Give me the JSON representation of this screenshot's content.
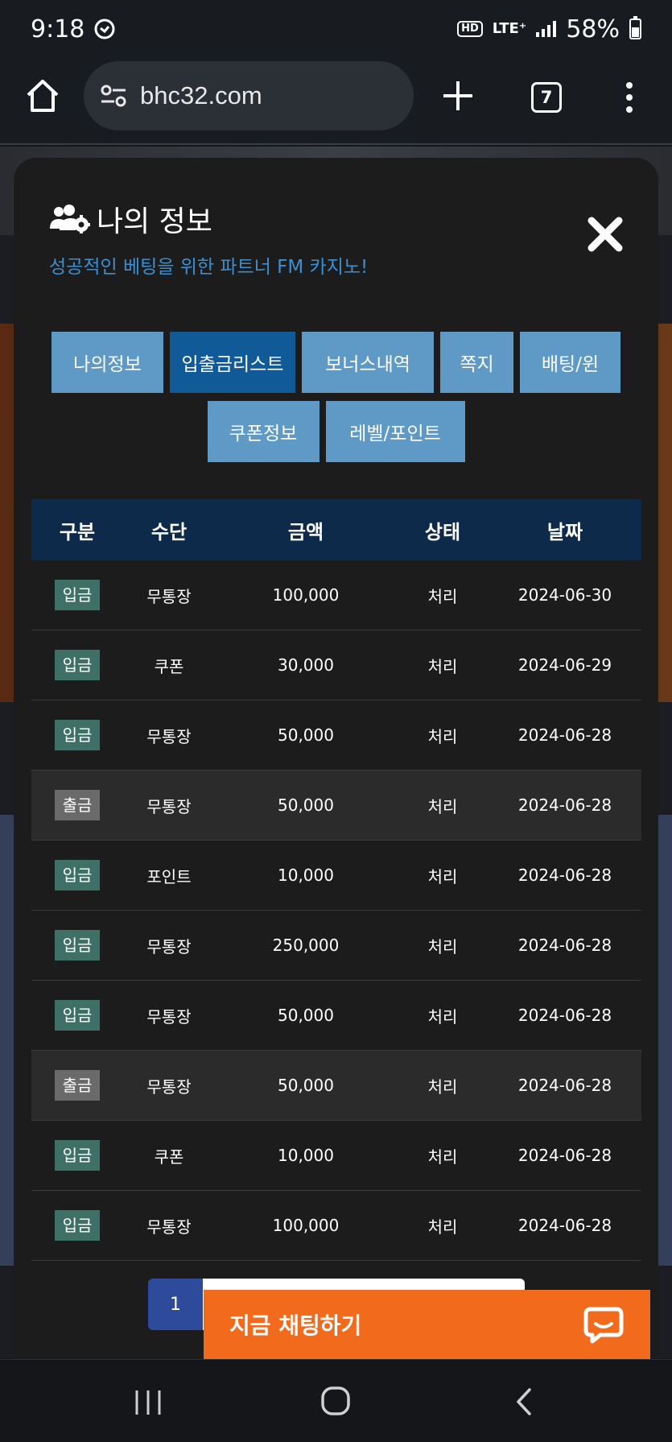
{
  "status_bar": {
    "time": "9:18",
    "hd_badge": "HD",
    "network": "LTE⁺",
    "battery": "58%"
  },
  "browser": {
    "url": "bhc32.com",
    "tab_count": "7"
  },
  "modal": {
    "title": "나의 정보",
    "subtitle": "성공적인 베팅을 위한 파트너 FM 카지노!",
    "tabs": [
      {
        "label": "나의정보",
        "active": false
      },
      {
        "label": "입출금리스트",
        "active": true
      },
      {
        "label": "보너스내역",
        "active": false
      },
      {
        "label": "쪽지",
        "active": false
      },
      {
        "label": "배팅/윈",
        "active": false
      },
      {
        "label": "쿠폰정보",
        "active": false
      },
      {
        "label": "레벨/포인트",
        "active": false
      }
    ],
    "table": {
      "headers": [
        "구분",
        "수단",
        "금액",
        "상태",
        "날짜"
      ],
      "rows": [
        {
          "type": "입금",
          "method": "무통장",
          "amount": "100,000",
          "status": "처리",
          "date": "2024-06-30"
        },
        {
          "type": "입금",
          "method": "쿠폰",
          "amount": "30,000",
          "status": "처리",
          "date": "2024-06-29"
        },
        {
          "type": "입금",
          "method": "무통장",
          "amount": "50,000",
          "status": "처리",
          "date": "2024-06-28"
        },
        {
          "type": "출금",
          "method": "무통장",
          "amount": "50,000",
          "status": "처리",
          "date": "2024-06-28"
        },
        {
          "type": "입금",
          "method": "포인트",
          "amount": "10,000",
          "status": "처리",
          "date": "2024-06-28"
        },
        {
          "type": "입금",
          "method": "무통장",
          "amount": "250,000",
          "status": "처리",
          "date": "2024-06-28"
        },
        {
          "type": "입금",
          "method": "무통장",
          "amount": "50,000",
          "status": "처리",
          "date": "2024-06-28"
        },
        {
          "type": "출금",
          "method": "무통장",
          "amount": "50,000",
          "status": "처리",
          "date": "2024-06-28"
        },
        {
          "type": "입금",
          "method": "쿠폰",
          "amount": "10,000",
          "status": "처리",
          "date": "2024-06-28"
        },
        {
          "type": "입금",
          "method": "무통장",
          "amount": "100,000",
          "status": "처리",
          "date": "2024-06-28"
        }
      ]
    },
    "pagination": {
      "current": "1"
    }
  },
  "chat": {
    "label": "지금 채팅하기"
  },
  "colors": {
    "deposit_badge": "#3e7066",
    "withdraw_badge": "#6a6a6a",
    "tab": "#5e9ac5",
    "tab_active": "#115a98",
    "header": "#0d2a4a",
    "subtitle": "#3c8fd1",
    "chat": "#f26a1b"
  }
}
